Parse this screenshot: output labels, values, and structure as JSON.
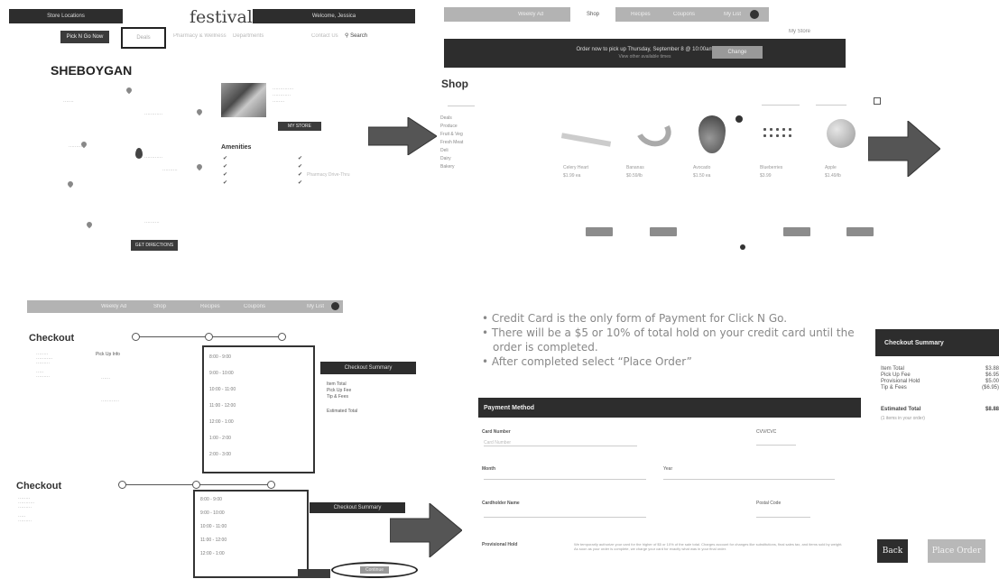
{
  "panel1": {
    "store_locations": "Store Locations",
    "logo": "festival",
    "welcome": "Welcome, Jessica",
    "pickup_button": "Pick N Go Now",
    "nav": [
      "Deals",
      "Pharmacy & Wellness",
      "Departments",
      "Contact Us"
    ],
    "search": "Search",
    "city_title": "SHEBOYGAN",
    "info_heading": "Amenities",
    "directions_button": "GET DIRECTIONS",
    "store_button": "MY STORE",
    "amenity_extra": "Pharmacy Drive-Thru"
  },
  "panel2": {
    "tabs": [
      "Weekly Ad",
      "Shop",
      "Recipes",
      "Coupons",
      "My List"
    ],
    "my_store": "My Store",
    "banner_line1": "Order now to pick up Thursday, September 8 @ 10:00am",
    "banner_line2": "View other available times",
    "change_button": "Change",
    "shop_title": "Shop",
    "categories": [
      "Deals",
      "Produce",
      "Fruit & Veg",
      "Fresh Meat",
      "Deli",
      "Dairy",
      "Bakery"
    ],
    "products": [
      {
        "name": "Celery Heart",
        "price": "$1.99 ea"
      },
      {
        "name": "Bananas",
        "price": "$0.59/lb"
      },
      {
        "name": "Avocado",
        "price": "$1.50 ea"
      },
      {
        "name": "Blueberries",
        "price": "$3.99"
      },
      {
        "name": "Apple",
        "price": "$1.49/lb"
      }
    ],
    "add_label": "Add"
  },
  "panel3": {
    "tabs": [
      "Weekly Ad",
      "Shop",
      "Recipes",
      "Coupons",
      "My List"
    ],
    "checkout_title": "Checkout",
    "summary_title": "Checkout Summary",
    "pickup_label": "Pick Up Info",
    "time_slots": [
      "8:00 - 9:00",
      "9:00 - 10:00",
      "10:00 - 11:00",
      "11:00 - 12:00",
      "12:00 - 1:00",
      "1:00 - 2:00",
      "2:00 - 3:00"
    ],
    "summary_rows": [
      "Item Total",
      "Pick Up Fee",
      "Tip & Fees"
    ],
    "estimated": "Estimated Total",
    "continue_button": "Continue"
  },
  "panel4": {
    "bullets": [
      "Credit Card is the only form of Payment for Click N Go.",
      "There will be a $5 or 10% of total hold on your credit card until the order is completed.",
      "After completed select “Place Order”"
    ],
    "payment_header": "Payment Method",
    "card_number_label": "Card Number",
    "card_number_placeholder": "Card Number",
    "cvv_label": "CVV/CVC",
    "month_label": "Month",
    "year_label": "Year",
    "cardholder_label": "Cardholder Name",
    "postal_label": "Postal Code",
    "provisional_label": "Provisional Hold",
    "provisional_text": "We temporarily authorize your card for the higher of $5 or 10% of the sale total. Charges account for changes like substitutions, final sales tax, and items sold by weight. As soon as your order is complete, we charge your card for exactly what was in your final order.",
    "summary_title": "Checkout Summary",
    "summary_rows": [
      {
        "label": "Item Total",
        "value": "$3.88"
      },
      {
        "label": "Pick Up Fee",
        "value": "$6.95"
      },
      {
        "label": "Provisional Hold",
        "value": "$5.00"
      },
      {
        "label": "Tip & Fees",
        "value": "($6.95)"
      }
    ],
    "estimated_label": "Estimated Total",
    "estimated_value": "$8.88",
    "estimated_note": "(1 items in your order)",
    "back_button": "Back",
    "place_order_button": "Place Order"
  },
  "colors": {
    "dark": "#2d2d2d",
    "arrow": "#555555",
    "accent_gray": "#b3b3b3"
  }
}
